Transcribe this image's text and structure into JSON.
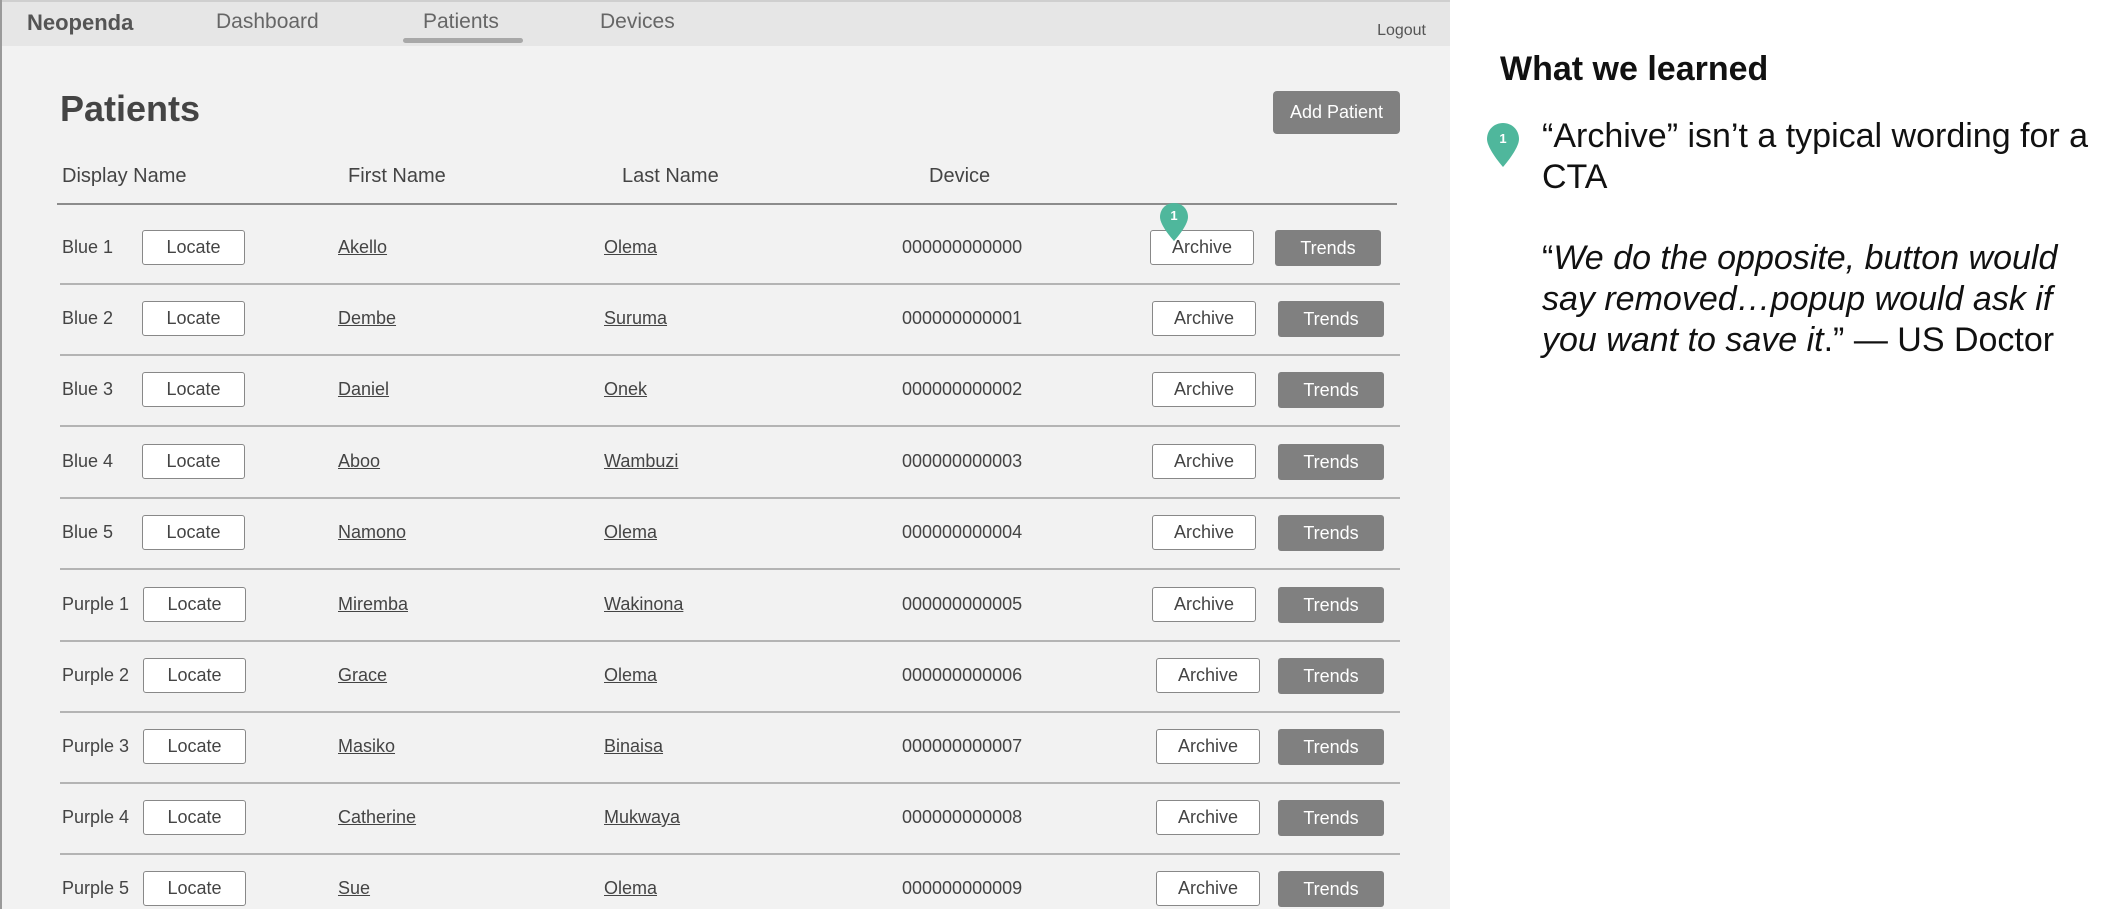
{
  "nav": {
    "brand": "Neopenda",
    "tabs": [
      {
        "label": "Dashboard"
      },
      {
        "label": "Patients",
        "active": true
      },
      {
        "label": "Devices"
      }
    ],
    "logout": "Logout"
  },
  "page": {
    "title": "Patients",
    "add_button": "Add Patient"
  },
  "table": {
    "columns": [
      "Display Name",
      "First Name",
      "Last Name",
      "Device"
    ],
    "locate_label": "Locate",
    "archive_label": "Archive",
    "trends_label": "Trends",
    "rows": [
      {
        "display": "Blue 1",
        "first": "Akello",
        "last": "Olema",
        "device": "000000000000"
      },
      {
        "display": "Blue 2",
        "first": "Dembe",
        "last": "Suruma",
        "device": "000000000001"
      },
      {
        "display": "Blue 3",
        "first": "Daniel",
        "last": "Onek",
        "device": "000000000002"
      },
      {
        "display": "Blue 4",
        "first": "Aboo",
        "last": "Wambuzi",
        "device": "000000000003"
      },
      {
        "display": "Blue 5",
        "first": "Namono",
        "last": "Olema",
        "device": "000000000004"
      },
      {
        "display": "Purple 1",
        "first": "Miremba",
        "last": "Wakinona",
        "device": "000000000005"
      },
      {
        "display": "Purple 2",
        "first": "Grace",
        "last": "Olema",
        "device": "000000000006"
      },
      {
        "display": "Purple 3",
        "first": "Masiko",
        "last": "Binaisa",
        "device": "000000000007"
      },
      {
        "display": "Purple 4",
        "first": "Catherine",
        "last": "Mukwaya",
        "device": "000000000008"
      },
      {
        "display": "Purple 5",
        "first": "Sue",
        "last": "Olema",
        "device": "000000000009"
      }
    ]
  },
  "annotation": {
    "number": "1",
    "color": "#4fb79c"
  },
  "notes": {
    "title": "What we learned",
    "marker_number": "1",
    "finding": "“Archive” isn’t a typical wording for a CTA",
    "quote_text": "We do the opposite, button would say removed…popup would ask if you want to save it",
    "quote_attribution": "— US Doctor"
  }
}
